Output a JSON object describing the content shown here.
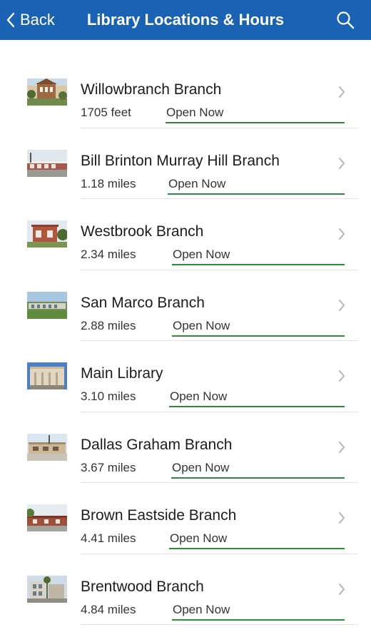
{
  "header": {
    "back_label": "Back",
    "title": "Library Locations & Hours",
    "background_color": "#1a63b4"
  },
  "icons": {
    "back": "chevron-left-icon",
    "search": "search-icon",
    "row_disclosure": "chevron-right-icon"
  },
  "status_color": "#2e8b3a",
  "branches": [
    {
      "name": "Willowbranch Branch",
      "distance": "1705 feet",
      "status": "Open Now"
    },
    {
      "name": "Bill Brinton Murray Hill Branch",
      "distance": "1.18 miles",
      "status": "Open Now"
    },
    {
      "name": "Westbrook Branch",
      "distance": "2.34 miles",
      "status": "Open Now"
    },
    {
      "name": "San Marco Branch",
      "distance": "2.88 miles",
      "status": "Open Now"
    },
    {
      "name": "Main Library",
      "distance": "3.10 miles",
      "status": "Open Now"
    },
    {
      "name": "Dallas Graham Branch",
      "distance": "3.67 miles",
      "status": "Open Now"
    },
    {
      "name": "Brown Eastside Branch",
      "distance": "4.41 miles",
      "status": "Open Now"
    },
    {
      "name": "Brentwood Branch",
      "distance": "4.84 miles",
      "status": "Open Now"
    }
  ]
}
